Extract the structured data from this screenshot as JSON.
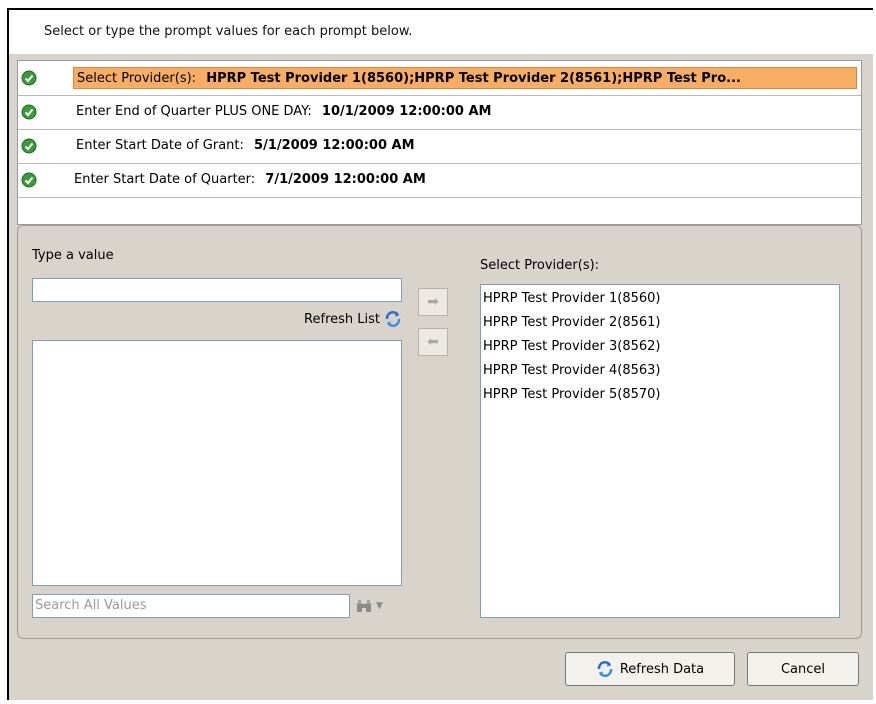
{
  "instructions": "Select or type the prompt values for each prompt below.",
  "prompts": [
    {
      "label": "Select Provider(s):",
      "value": "HPRP Test Provider 1(8560);HPRP Test Provider 2(8561);HPRP Test Pro...",
      "selected": true,
      "status_icon": "check-icon"
    },
    {
      "label": "Enter End of Quarter PLUS ONE DAY:",
      "value": "10/1/2009 12:00:00 AM",
      "selected": false,
      "status_icon": "check-icon"
    },
    {
      "label": "Enter Start Date of Grant:",
      "value": "5/1/2009 12:00:00 AM",
      "selected": false,
      "status_icon": "check-icon"
    },
    {
      "label": "Enter Start Date of Quarter:",
      "value": "7/1/2009 12:00:00 AM",
      "selected": false,
      "status_icon": "check-icon"
    }
  ],
  "left_panel": {
    "type_value_label": "Type a value",
    "type_value": "",
    "refresh_list_label": "Refresh List",
    "search_placeholder": "Search All Values",
    "available_values": []
  },
  "right_panel": {
    "label": "Select Provider(s):",
    "selected_values": [
      "HPRP Test Provider 1(8560)",
      "HPRP Test Provider 2(8561)",
      "HPRP Test Provider 3(8562)",
      "HPRP Test Provider 4(8563)",
      "HPRP Test Provider 5(8570)"
    ]
  },
  "buttons": {
    "refresh_data": "Refresh Data",
    "cancel": "Cancel"
  },
  "colors": {
    "selected_row": "#f7ae64",
    "dialog_bg": "#d8d4cc",
    "check_green": "#3c9a3c"
  }
}
